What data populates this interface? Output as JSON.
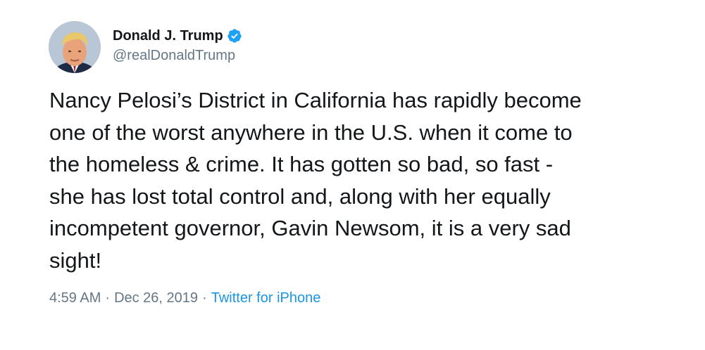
{
  "author": {
    "display_name": "Donald J. Trump",
    "handle": "@realDonaldTrump",
    "verified": true,
    "verified_icon": "verified-badge-icon",
    "verified_color": "#1da1f2"
  },
  "tweet": {
    "text": "Nancy Pelosi’s District in California has rapidly become\none of the worst anywhere in the U.S. when it come to\nthe homeless & crime. It has gotten so bad, so fast -\nshe has lost total control and, along with her equally\nincompetent governor, Gavin Newsom, it is a very sad\nsight!"
  },
  "meta": {
    "time": "4:59 AM",
    "separator": "·",
    "date": "Dec 26, 2019",
    "source": "Twitter for iPhone"
  },
  "colors": {
    "text": "#14171a",
    "secondary": "#657786",
    "link": "#1b95e0"
  }
}
